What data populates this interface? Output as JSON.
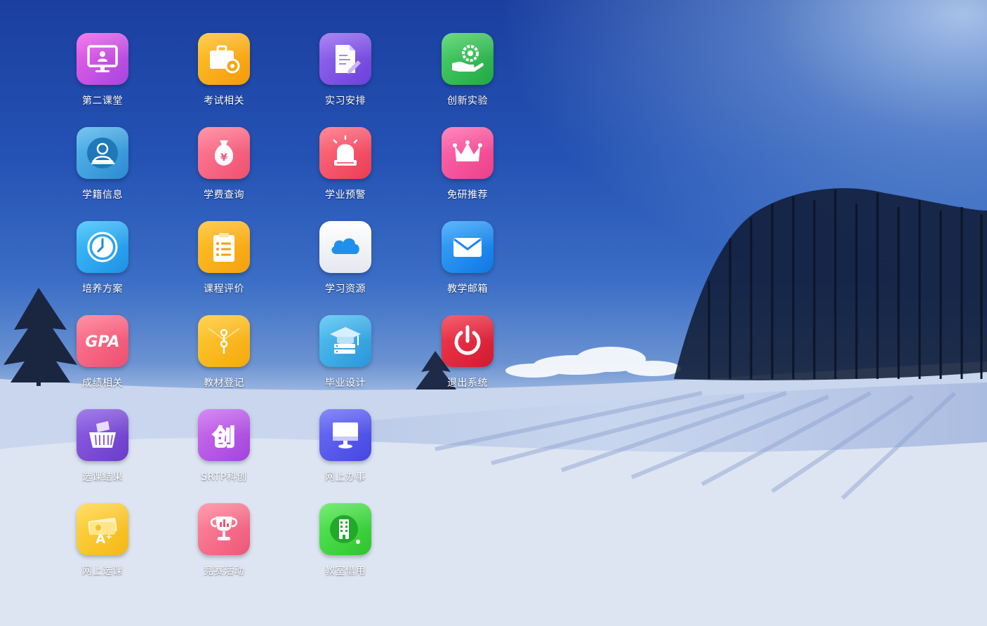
{
  "desktop": {
    "apps": [
      {
        "label": "第二课堂",
        "icon": "monitor-person-icon",
        "color": "#c24fe0"
      },
      {
        "label": "考试相关",
        "icon": "briefcase-gear-icon",
        "color": "#f5a20c"
      },
      {
        "label": "实习安排",
        "icon": "document-pen-icon",
        "color": "#7b55e8"
      },
      {
        "label": "创新实验",
        "icon": "hand-gear-icon",
        "color": "#2fb455"
      },
      {
        "label": "学籍信息",
        "icon": "student-avatar-icon",
        "color": "#3a9fd8"
      },
      {
        "label": "学费查询",
        "icon": "money-bag-icon",
        "color": "#f2607a"
      },
      {
        "label": "学业预警",
        "icon": "alarm-light-icon",
        "color": "#f04860"
      },
      {
        "label": "免研推荐",
        "icon": "crown-icon",
        "color": "#f2509a"
      },
      {
        "label": "培养方案",
        "icon": "clock-icon",
        "color": "#29a8ef"
      },
      {
        "label": "课程评价",
        "icon": "clipboard-list-icon",
        "color": "#f6a80c"
      },
      {
        "label": "学习资源",
        "icon": "cloud-icon",
        "color": "#f4f4f6"
      },
      {
        "label": "教学邮箱",
        "icon": "mail-icon",
        "color": "#1e8ff0"
      },
      {
        "label": "成绩相关",
        "icon": "gpa-icon",
        "color": "#f6607e",
        "text": "GPA"
      },
      {
        "label": "教材登记",
        "icon": "envelope-clip-icon",
        "color": "#f7b51a"
      },
      {
        "label": "毕业设计",
        "icon": "graduation-cap-server-icon",
        "color": "#38b0e8"
      },
      {
        "label": "退出系统",
        "icon": "power-icon",
        "color": "#e4283c"
      },
      {
        "label": "选课结果",
        "icon": "shopping-basket-icon",
        "color": "#7e4bd6"
      },
      {
        "label": "SRTP科创",
        "icon": "chuang-character-icon",
        "color": "#b950e6",
        "text": "创"
      },
      {
        "label": "网上办事",
        "icon": "desktop-computer-icon",
        "color": "#5b5ef0"
      },
      {
        "label": "网上选课",
        "icon": "grade-a-plus-icon",
        "color": "#f7c92a",
        "text": "A⁺"
      },
      {
        "label": "竞赛活动",
        "icon": "trophy-icon",
        "color": "#f56c84"
      },
      {
        "label": "教室借用",
        "icon": "building-icon",
        "color": "#3dd63a"
      }
    ]
  }
}
